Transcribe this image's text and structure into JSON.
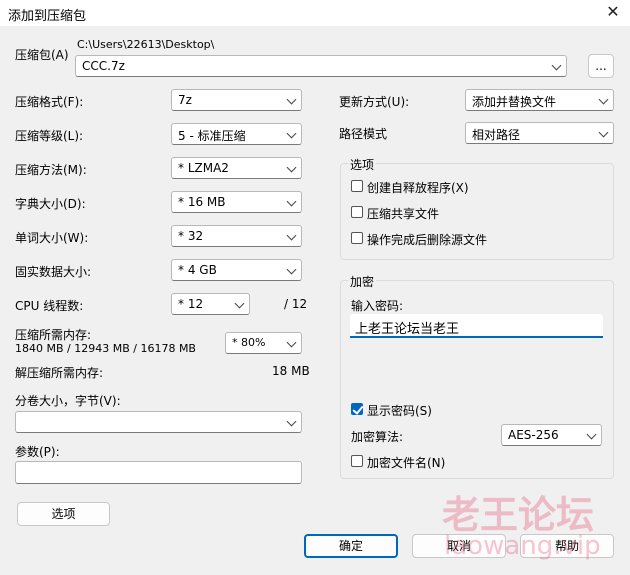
{
  "window": {
    "title": "添加到压缩包",
    "close_glyph": "✕"
  },
  "archive": {
    "label": "压缩包(A)",
    "path": "C:\\Users\\22613\\Desktop\\",
    "name": "CCC.7z",
    "browse_label": "..."
  },
  "left": {
    "format": {
      "label": "压缩格式(F):",
      "value": "7z"
    },
    "level": {
      "label": "压缩等级(L):",
      "value": "5 - 标准压缩"
    },
    "method": {
      "label": "压缩方法(M):",
      "value": "*  LZMA2"
    },
    "dict": {
      "label": "字典大小(D):",
      "value": "*  16 MB"
    },
    "word": {
      "label": "单词大小(W):",
      "value": "*  32"
    },
    "solid": {
      "label": "固实数据大小:",
      "value": "*  4 GB"
    },
    "threads": {
      "label": "CPU 线程数:",
      "value": "*  12",
      "total": "/ 12"
    },
    "mem_comp": {
      "label": "压缩所需内存:",
      "detail": "1840 MB / 12943 MB / 16178 MB",
      "value": "* 80%"
    },
    "mem_decomp": {
      "label": "解压缩所需内存:",
      "value": "18 MB"
    },
    "volume": {
      "label": "分卷大小，字节(V):",
      "value": ""
    },
    "params": {
      "label": "参数(P):",
      "value": ""
    },
    "options_button": "选项"
  },
  "right": {
    "update": {
      "label": "更新方式(U):",
      "value": "添加并替换文件"
    },
    "path_mode": {
      "label": "路径模式",
      "value": "相对路径"
    },
    "options_group": {
      "title": "选项",
      "items": [
        {
          "label": "创建自释放程序(X)",
          "checked": false
        },
        {
          "label": "压缩共享文件",
          "checked": false
        },
        {
          "label": "操作完成后删除源文件",
          "checked": false
        }
      ]
    },
    "encryption": {
      "title": "加密",
      "password_label": "输入密码:",
      "password_value": "上老王论坛当老王",
      "show_password": {
        "label": "显示密码(S)",
        "checked": true
      },
      "method_label": "加密算法:",
      "method_value": "AES-256",
      "encrypt_names": {
        "label": "加密文件名(N)",
        "checked": false
      }
    }
  },
  "buttons": {
    "ok": "确定",
    "cancel": "取消",
    "help": "帮助"
  },
  "watermark": {
    "text": "老王论坛",
    "url": "laowang.vip"
  }
}
